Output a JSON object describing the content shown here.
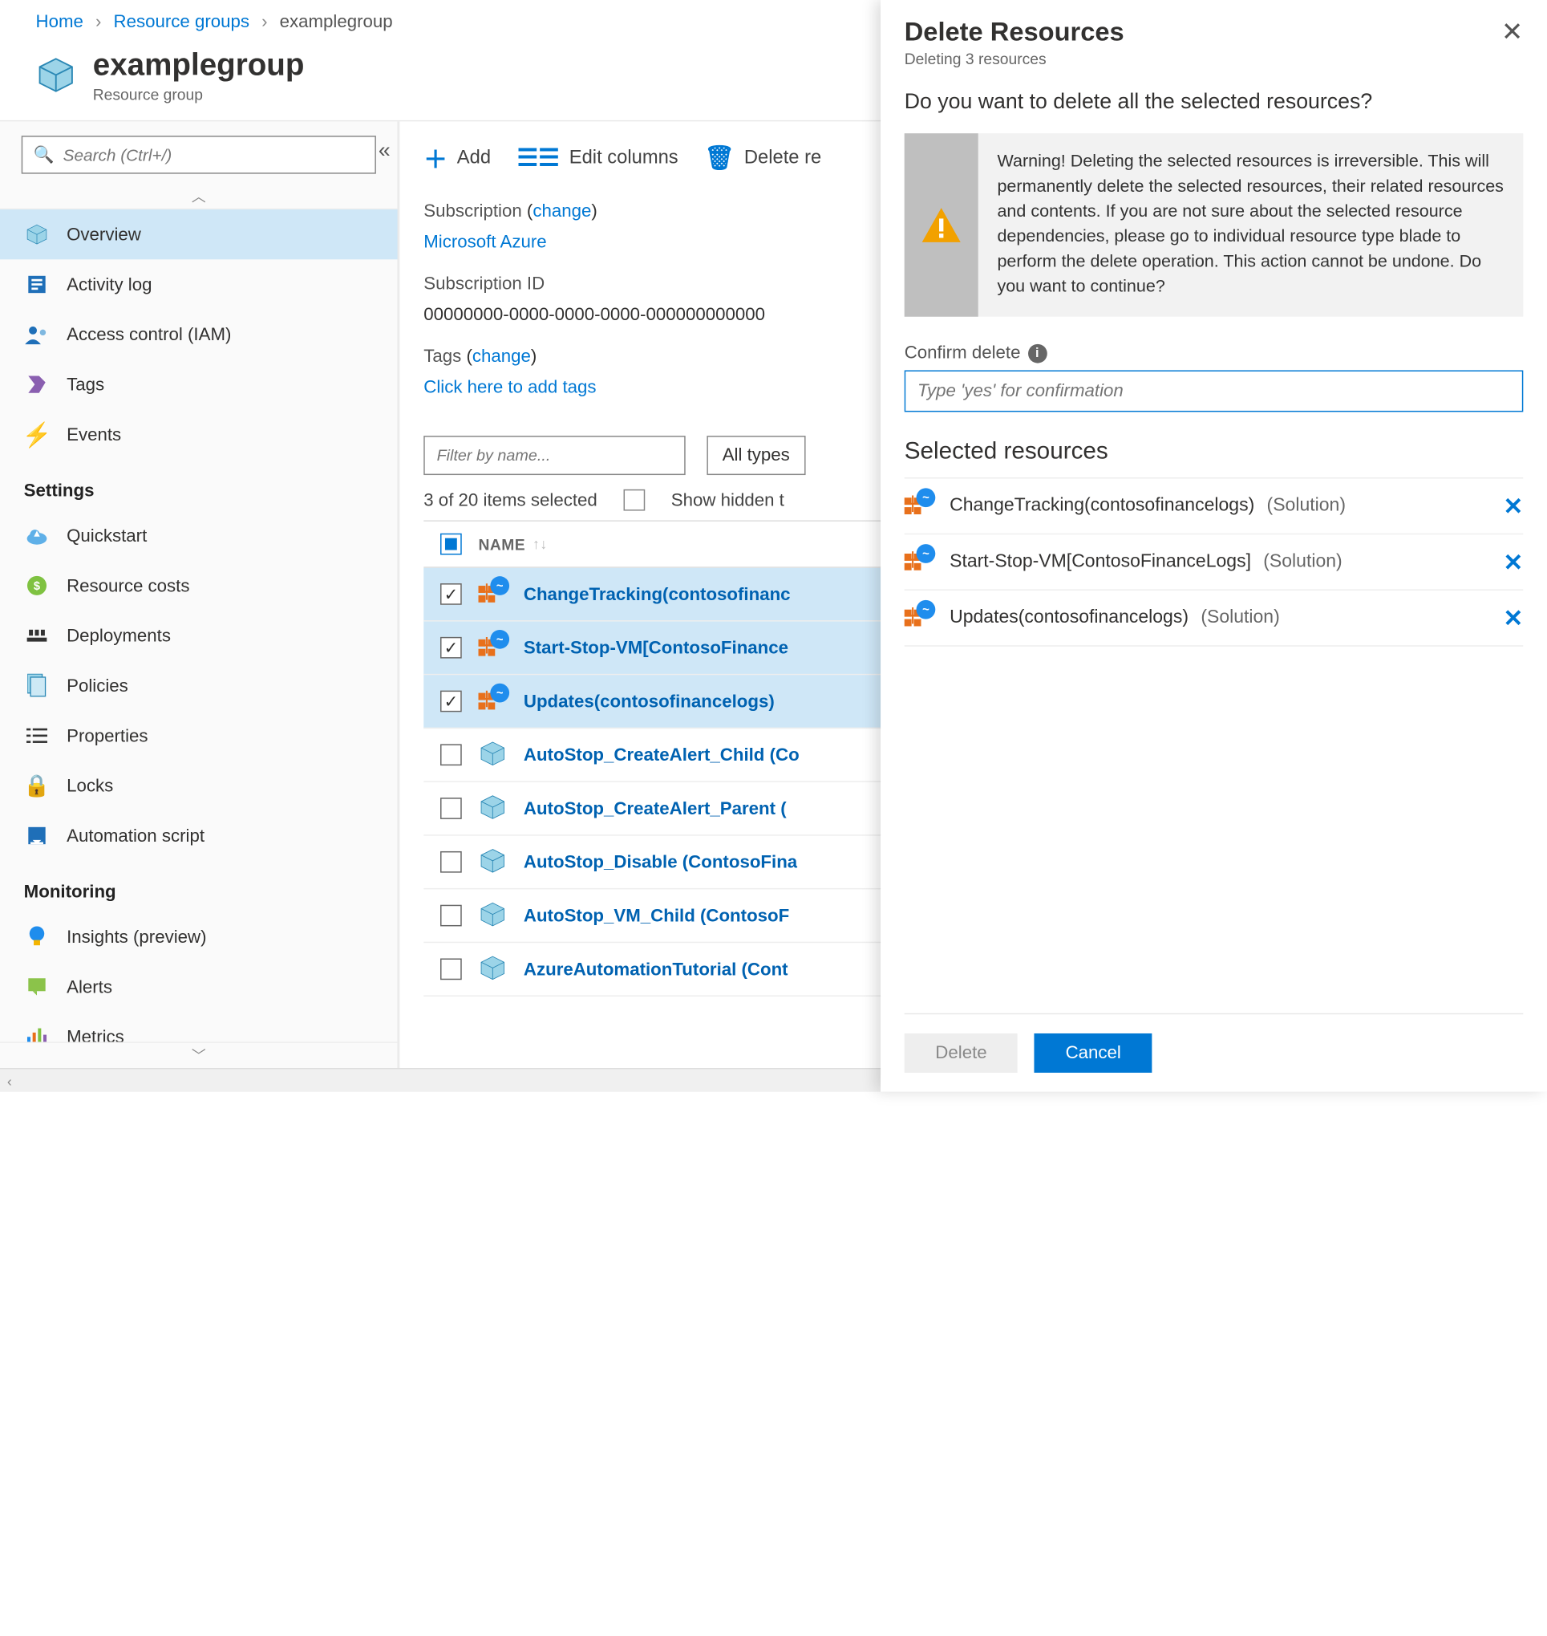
{
  "breadcrumb": {
    "home": "Home",
    "rg": "Resource groups",
    "current": "examplegroup"
  },
  "header": {
    "title": "examplegroup",
    "subtitle": "Resource group"
  },
  "sidebar": {
    "search_placeholder": "Search (Ctrl+/)",
    "items": [
      {
        "icon": "cube",
        "label": "Overview",
        "active": true
      },
      {
        "icon": "log",
        "label": "Activity log"
      },
      {
        "icon": "iam",
        "label": "Access control (IAM)"
      },
      {
        "icon": "tag",
        "label": "Tags"
      },
      {
        "icon": "bolt",
        "label": "Events"
      }
    ],
    "settings_label": "Settings",
    "settings": [
      {
        "icon": "cloud",
        "label": "Quickstart"
      },
      {
        "icon": "cost",
        "label": "Resource costs"
      },
      {
        "icon": "deploy",
        "label": "Deployments"
      },
      {
        "icon": "policy",
        "label": "Policies"
      },
      {
        "icon": "prop",
        "label": "Properties"
      },
      {
        "icon": "lock",
        "label": "Locks"
      },
      {
        "icon": "script",
        "label": "Automation script"
      }
    ],
    "monitoring_label": "Monitoring",
    "monitoring": [
      {
        "icon": "bulb",
        "label": "Insights (preview)"
      },
      {
        "icon": "alert",
        "label": "Alerts"
      },
      {
        "icon": "metric",
        "label": "Metrics"
      }
    ]
  },
  "toolbar": {
    "add": "Add",
    "edit": "Edit columns",
    "delete": "Delete re"
  },
  "meta": {
    "sub_label": "Subscription",
    "change": "change",
    "sub_value": "Microsoft Azure",
    "subid_label": "Subscription ID",
    "subid_value": "00000000-0000-0000-0000-000000000000",
    "tags_label": "Tags",
    "tags_link": "Click here to add tags"
  },
  "filter": {
    "placeholder": "Filter by name...",
    "types": "All types"
  },
  "count": {
    "text": "3 of 20 items selected",
    "hidden": "Show hidden t"
  },
  "tableHeader": {
    "name": "NAME"
  },
  "rows": [
    {
      "checked": true,
      "kind": "solution",
      "name": "ChangeTracking(contosofinanc"
    },
    {
      "checked": true,
      "kind": "solution",
      "name": "Start-Stop-VM[ContosoFinance"
    },
    {
      "checked": true,
      "kind": "solution",
      "name": "Updates(contosofinancelogs)"
    },
    {
      "checked": false,
      "kind": "cube",
      "name": "AutoStop_CreateAlert_Child (Co"
    },
    {
      "checked": false,
      "kind": "cube",
      "name": "AutoStop_CreateAlert_Parent ("
    },
    {
      "checked": false,
      "kind": "cube",
      "name": "AutoStop_Disable (ContosoFina"
    },
    {
      "checked": false,
      "kind": "cube",
      "name": "AutoStop_VM_Child (ContosoF"
    },
    {
      "checked": false,
      "kind": "cube",
      "name": "AzureAutomationTutorial (Cont"
    }
  ],
  "panel": {
    "title": "Delete Resources",
    "subtitle": "Deleting 3 resources",
    "question": "Do you want to delete all the selected resources?",
    "warning": "Warning! Deleting the selected resources is irreversible. This will permanently delete the selected resources, their related resources and contents. If you are not sure about the selected resource dependencies, please go to individual resource type blade to perform the delete operation. This action cannot be undone. Do you want to continue?",
    "confirm_label": "Confirm delete",
    "confirm_placeholder": "Type 'yes' for confirmation",
    "selected_label": "Selected resources",
    "selected": [
      {
        "name": "ChangeTracking(contosofinancelogs)",
        "type": "(Solution)"
      },
      {
        "name": "Start-Stop-VM[ContosoFinanceLogs]",
        "type": "(Solution)"
      },
      {
        "name": "Updates(contosofinancelogs)",
        "type": "(Solution)"
      }
    ],
    "delete_btn": "Delete",
    "cancel_btn": "Cancel"
  }
}
